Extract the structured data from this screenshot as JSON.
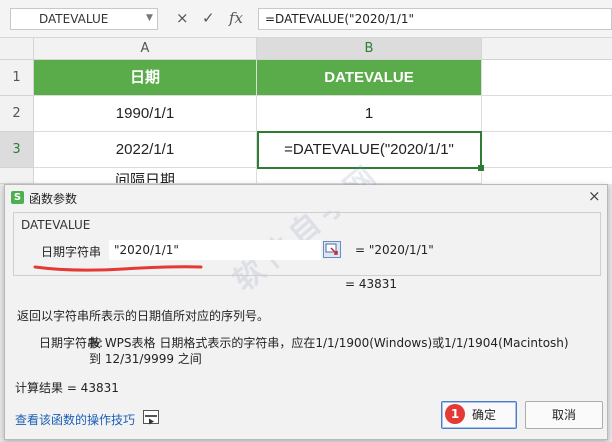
{
  "formula_bar": {
    "name_box": "DATEVALUE",
    "cancel_icon": "×",
    "enter_icon": "✓",
    "fx_label": "fx",
    "formula": "=DATEVALUE(\"2020/1/1\""
  },
  "sheet": {
    "columns": [
      "A",
      "B"
    ],
    "rows": [
      "1",
      "2",
      "3"
    ],
    "header": {
      "a": "日期",
      "b": "DATEVALUE"
    },
    "row2": {
      "a": "1990/1/1",
      "b": "1"
    },
    "row3": {
      "a": "2022/1/1",
      "b": "=DATEVALUE(\"2020/1/1\""
    },
    "row4_partial": "间隔日期",
    "header_color": "#5aab4a"
  },
  "dialog": {
    "title": "函数参数",
    "close_icon": "×",
    "function_name": "DATEVALUE",
    "arg_label": "日期字符串",
    "arg_value": "\"2020/1/1\"",
    "arg_eval": "= \"2020/1/1\"",
    "result_eval": "= 43831",
    "description": "返回以字符串所表示的日期值所对应的序列号。",
    "param_label": "日期字符串:",
    "param_desc_line1": "按 WPS表格 日期格式表示的字符串，应在1/1/1900(Windows)或1/1/1904(Macintosh)",
    "param_desc_line2": "到 12/31/9999 之间",
    "calc_result": "计算结果 =  43831",
    "tips_link": "查看该函数的操作技巧",
    "ok_label": "确定",
    "cancel_label": "取消",
    "badge": "1",
    "watermark": "软件自学网",
    "accent_color": "#4a7cc9",
    "annotation_color": "#e53935"
  }
}
